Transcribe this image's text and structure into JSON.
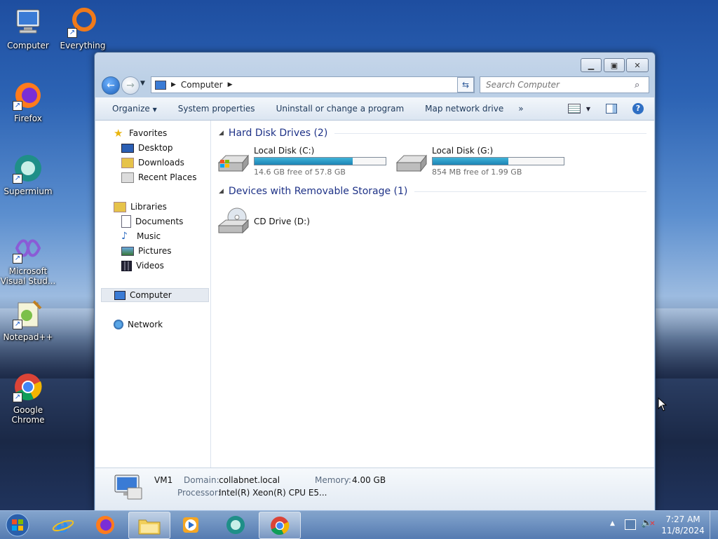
{
  "desktop": {
    "icons": [
      {
        "label": "Computer"
      },
      {
        "label": "Everything"
      },
      {
        "label": "Firefox"
      },
      {
        "label": "Supermium"
      },
      {
        "label": "Microsoft Visual Stud..."
      },
      {
        "label": "Notepad++"
      },
      {
        "label": "Google Chrome"
      }
    ]
  },
  "window": {
    "address": {
      "location": "Computer"
    },
    "search": {
      "placeholder": "Search Computer"
    },
    "toolbar": {
      "organize": "Organize",
      "system_properties": "System properties",
      "uninstall": "Uninstall or change a program",
      "map_drive": "Map network drive",
      "more": "»"
    },
    "nav": {
      "favorites": "Favorites",
      "desktop": "Desktop",
      "downloads": "Downloads",
      "recent": "Recent Places",
      "libraries": "Libraries",
      "documents": "Documents",
      "music": "Music",
      "pictures": "Pictures",
      "videos": "Videos",
      "computer": "Computer",
      "network": "Network"
    },
    "groups": {
      "hdd": "Hard Disk Drives (2)",
      "removable": "Devices with Removable Storage (1)"
    },
    "drives": [
      {
        "name": "Local Disk (C:)",
        "free": "14.6 GB free of 57.8 GB",
        "used_fraction": 0.75
      },
      {
        "name": "Local Disk (G:)",
        "free": "854 MB free of 1.99 GB",
        "used_fraction": 0.58
      }
    ],
    "cd": {
      "name": "CD Drive (D:)"
    },
    "details": {
      "computer_name": "VM1",
      "domain_label": "Domain:",
      "domain_value": "collabnet.local",
      "memory_label": "Memory:",
      "memory_value": "4.00 GB",
      "processor_label": "Processor:",
      "processor_value": "Intel(R) Xeon(R) CPU E5..."
    }
  },
  "taskbar": {
    "time": "7:27 AM",
    "date": "11/8/2024"
  },
  "colors": {
    "accent": "#1e3287",
    "progress": "#1d84b5"
  }
}
